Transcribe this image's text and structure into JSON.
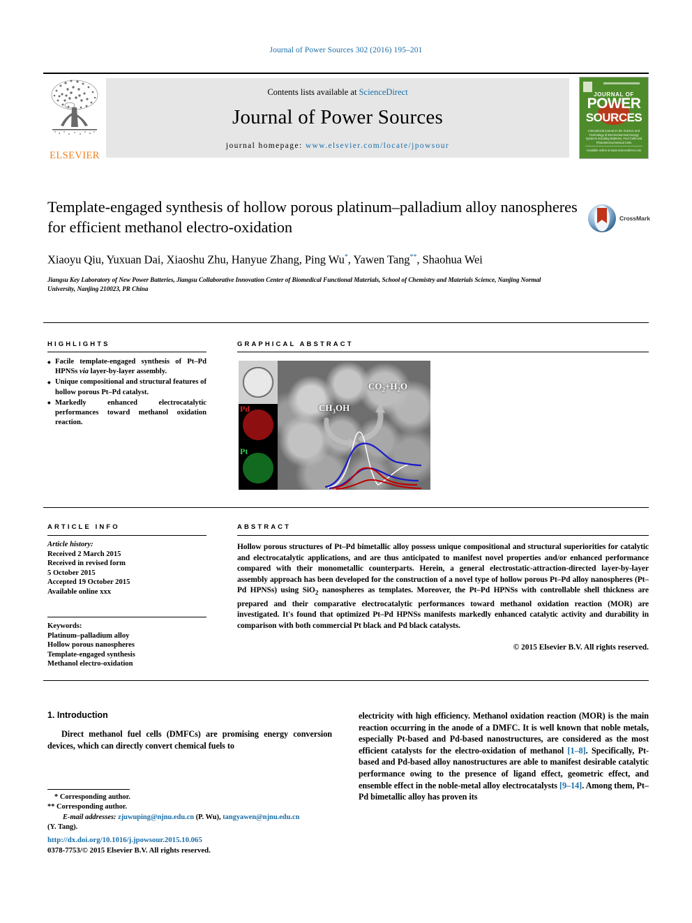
{
  "running_head": "Journal of Power Sources 302 (2016) 195–201",
  "masthead": {
    "elsevier_wordmark": "ELSEVIER",
    "contents_prefix": "Contents lists available at ",
    "contents_link": "ScienceDirect",
    "journal_title": "Journal of Power Sources",
    "homepage_prefix": "journal homepage: ",
    "homepage_url": "www.elsevier.com/locate/jpowsour",
    "cover": {
      "line_journal_of": "JOURNAL OF",
      "line_power": "POWER",
      "line_sources": "SOURCES",
      "blurb": "International journal on the Science and Technology of Electrochemical Energy Systems including Batteries, Fuel Cells and Photoelectrochemical Cells",
      "bottom": "Available online at\nwww.sciencedirect.com"
    }
  },
  "article": {
    "title": "Template-engaged synthesis of hollow porous platinum–palladium alloy nanospheres for efficient methanol electro-oxidation",
    "authors": "Xiaoyu Qiu, Yuxuan Dai, Xiaoshu Zhu, Hanyue Zhang, Ping Wu, Yawen Tang, Shaohua Wei",
    "affiliation": "Jiangsu Key Laboratory of New Power Batteries, Jiangsu Collaborative Innovation Center of Biomedical Functional Materials, School of Chemistry and Materials Science, Nanjing Normal University, Nanjing 210023, PR China",
    "crossmark_label": "CrossMark"
  },
  "highlights": {
    "heading": "HIGHLIGHTS",
    "items": [
      "Facile template-engaged synthesis of Pt–Pd HPNSs via layer-by-layer assembly.",
      "Unique compositional and structural features of hollow porous Pt–Pd catalyst.",
      "Markedly enhanced electrocatalytic performances toward methanol oxidation reaction."
    ]
  },
  "graphical_abstract": {
    "heading": "GRAPHICAL ABSTRACT",
    "labels": {
      "reactant": "CH3OH",
      "product": "CO2+H2O",
      "inset_pd": "Pd",
      "inset_pt": "Pt"
    }
  },
  "article_info": {
    "heading": "ARTICLE INFO",
    "history_label": "Article history:",
    "history": [
      "Received 2 March 2015",
      "Received in revised form",
      "5 October 2015",
      "Accepted 19 October 2015",
      "Available online xxx"
    ],
    "keywords_label": "Keywords:",
    "keywords": [
      "Platinum–palladium alloy",
      "Hollow porous nanospheres",
      "Template-engaged synthesis",
      "Methanol electro-oxidation"
    ]
  },
  "abstract": {
    "heading": "ABSTRACT",
    "text": "Hollow porous structures of Pt–Pd bimetallic alloy possess unique compositional and structural superiorities for catalytic and electrocatalytic applications, and are thus anticipated to manifest novel properties and/or enhanced performance compared with their monometallic counterparts. Herein, a general electrostatic-attraction-directed layer-by-layer assembly approach has been developed for the construction of a novel type of hollow porous Pt–Pd alloy nanospheres (Pt–Pd HPNSs) using SiO2 nanospheres as templates. Moreover, the Pt–Pd HPNSs with controllable shell thickness are prepared and their comparative electrocatalytic performances toward methanol oxidation reaction (MOR) are investigated. It's found that optimized Pt–Pd HPNSs manifests markedly enhanced catalytic activity and durability in comparison with both commercial Pt black and Pd black catalysts.",
    "copyright": "© 2015 Elsevier B.V. All rights reserved."
  },
  "body": {
    "section_title": "1. Introduction",
    "left_paragraph": "Direct methanol fuel cells (DMFCs) are promising energy conversion devices, which can directly convert chemical fuels to",
    "right_paragraph_part1": "electricity with high efficiency. Methanol oxidation reaction (MOR) is the main reaction occurring in the anode of a DMFC. It is well known that noble metals, especially Pt-based and Pd-based nanostructures, are considered as the most efficient catalysts for the electro-oxidation of methanol ",
    "right_ref1": "[1–8]",
    "right_paragraph_part2": ". Specifically, Pt-based and Pd-based alloy nanostructures are able to manifest desirable catalytic performance owing to the presence of ligand effect, geometric effect, and ensemble effect in the noble-metal alloy electrocatalysts ",
    "right_ref2": "[9–14]",
    "right_paragraph_part3": ". Among them, Pt–Pd bimetallic alloy has proven its"
  },
  "footnotes": {
    "star_one": "*",
    "star_two": "**",
    "corresponding_one": "Corresponding author.",
    "corresponding_two": "Corresponding author.",
    "email_label": "E-mail addresses:",
    "email1": "zjuwuping@njnu.edu.cn",
    "email1_owner": "(P. Wu)",
    "email2": "tangyawen@njnu.edu.cn",
    "email2_owner": "(Y. Tang)."
  },
  "doi": {
    "url": "http://dx.doi.org/10.1016/j.jpowsour.2015.10.065",
    "issn_line": "0378-7753/© 2015 Elsevier B.V. All rights reserved."
  },
  "colors": {
    "link_blue": "#1a6ea8",
    "elsevier_orange": "#f07f1a",
    "cover_green": "#4e8c2b",
    "banner_gray": "#e6e6e6"
  }
}
